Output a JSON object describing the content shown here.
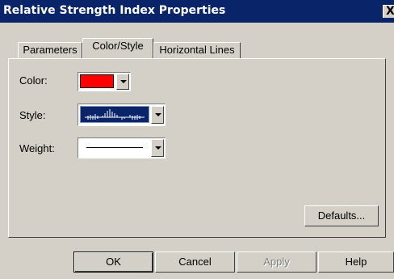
{
  "window": {
    "title": "Relative Strength Index Properties",
    "close_symbol": "X"
  },
  "tabs": [
    {
      "label": "Parameters",
      "active": false
    },
    {
      "label": "Color/Style",
      "active": true
    },
    {
      "label": "Horizontal Lines",
      "active": false
    }
  ],
  "form": {
    "color_label": "Color:",
    "color_value": "#ff0000",
    "style_label": "Style:",
    "style_value": "histogram",
    "weight_label": "Weight:",
    "weight_value": "thin line"
  },
  "buttons": {
    "defaults": "Defaults...",
    "ok": "OK",
    "cancel": "Cancel",
    "apply": "Apply",
    "apply_enabled": false,
    "help": "Help"
  },
  "colors": {
    "title_bar": "#0a246a",
    "dialog_face": "#d4d0c8",
    "selection": "#0a246a"
  }
}
